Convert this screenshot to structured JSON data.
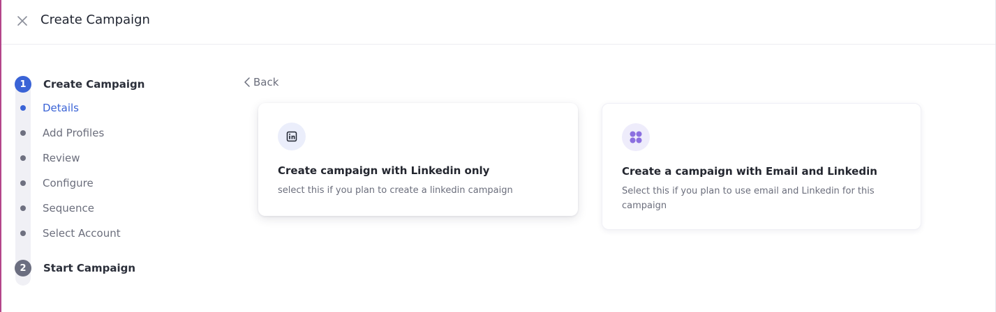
{
  "header": {
    "title": "Create Campaign"
  },
  "stepper": {
    "steps": [
      {
        "number": "1",
        "label": "Create Campaign",
        "color": "#3a63d6",
        "substeps": [
          {
            "label": "Details",
            "active": true
          },
          {
            "label": "Add Profiles",
            "active": false
          },
          {
            "label": "Review",
            "active": false
          },
          {
            "label": "Configure",
            "active": false
          },
          {
            "label": "Sequence",
            "active": false
          },
          {
            "label": "Select Account",
            "active": false
          }
        ]
      },
      {
        "number": "2",
        "label": "Start Campaign",
        "color": "#6b6e80",
        "substeps": []
      }
    ]
  },
  "main": {
    "back_label": "Back",
    "cards": [
      {
        "icon": "linkedin-icon",
        "title": "Create campaign with Linkedin only",
        "description": "select this if you plan to create a linkedin campaign"
      },
      {
        "icon": "grid-apps-icon",
        "title": "Create a campaign with Email and Linkedin",
        "description": "Select this if you plan to use email and Linkedin for this campaign"
      }
    ]
  },
  "colors": {
    "accent": "#3a63d6",
    "purple_icon": "#8b6fe0",
    "muted_text": "#6b6e7c"
  }
}
